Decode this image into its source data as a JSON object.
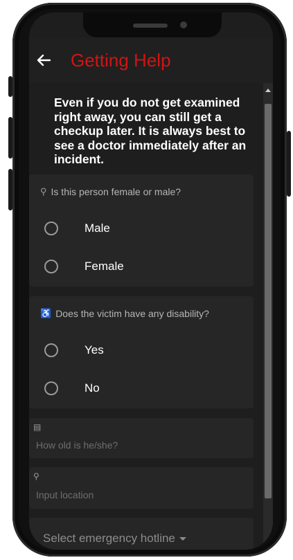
{
  "header": {
    "title": "Getting Help",
    "back_icon": "arrow-left-icon"
  },
  "info_text": "Even if you do not get examined right away, you can still get a checkup later. It is always best to see a doctor immediately after an incident.",
  "questions": [
    {
      "icon": "gender-icon",
      "question": "Is this person female or male?",
      "options": [
        "Male",
        "Female"
      ]
    },
    {
      "icon": "accessibility-icon",
      "question": "Does the victim have any disability?",
      "options": [
        "Yes",
        "No"
      ]
    }
  ],
  "fields": [
    {
      "icon": "calendar-icon",
      "placeholder": "How old is he/she?"
    },
    {
      "icon": "location-pin-icon",
      "placeholder": "Input location"
    }
  ],
  "hotline_select": {
    "label": "Select emergency hotline"
  },
  "colors": {
    "title": "#d01414",
    "background": "#1e1e1e",
    "card": "#262626"
  }
}
